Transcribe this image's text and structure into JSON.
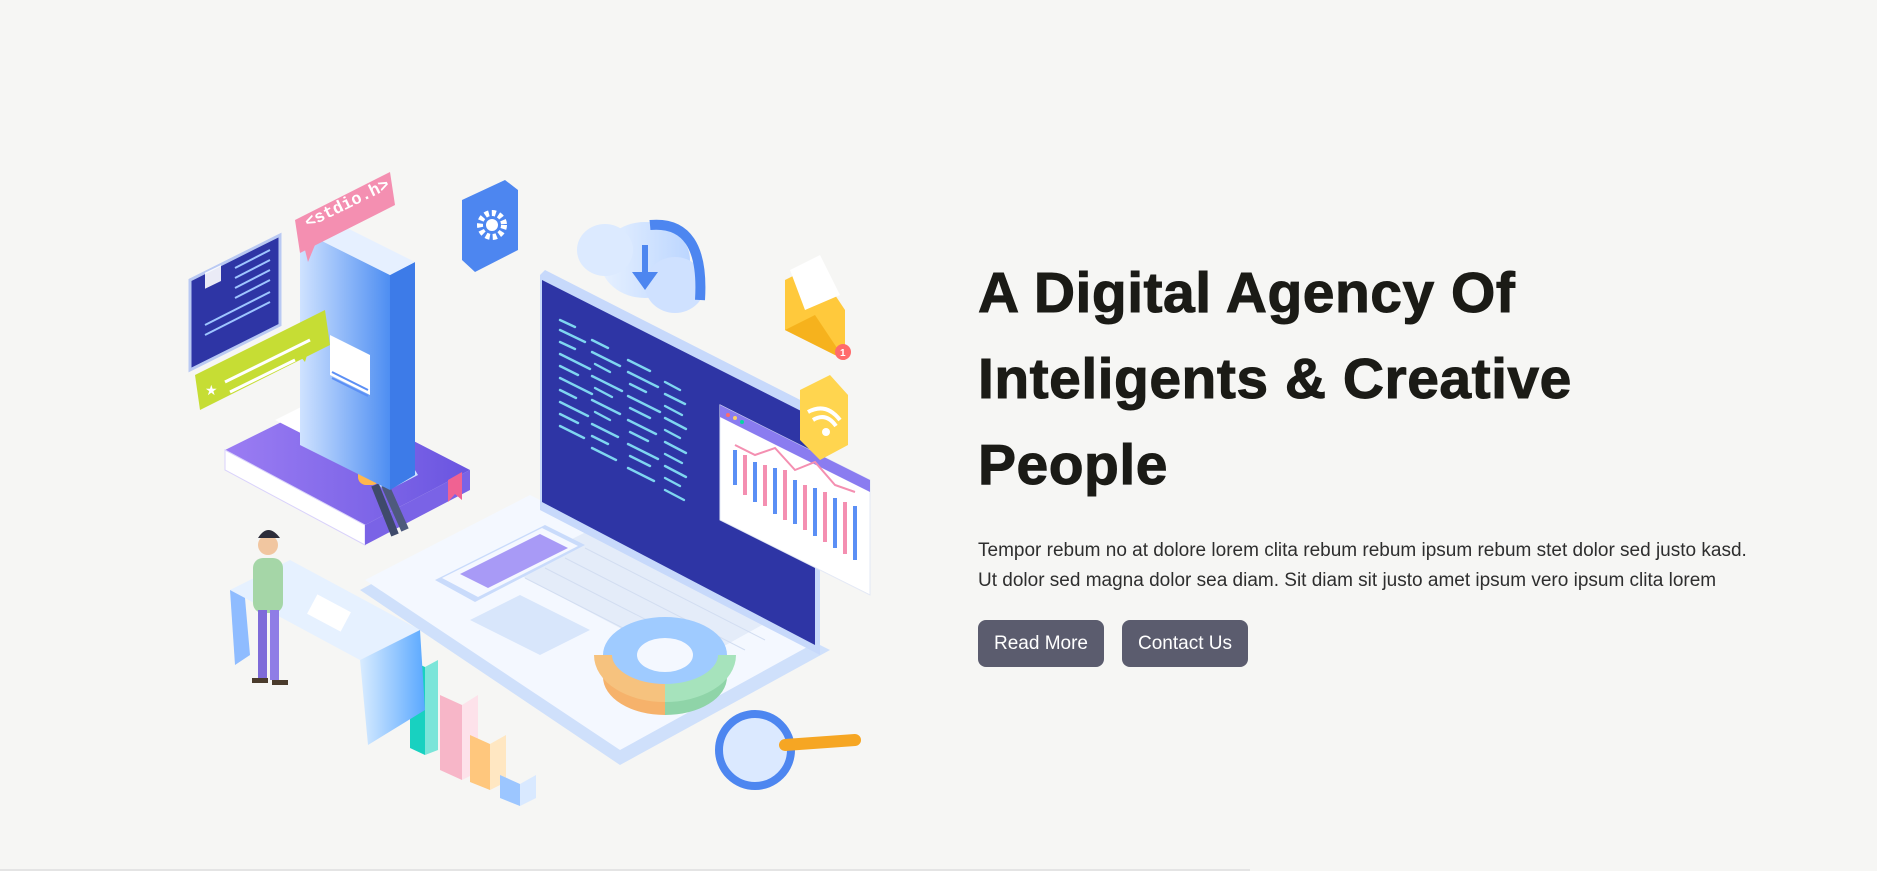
{
  "hero": {
    "title_lines": [
      "A Digital Agency Of",
      "Inteligents & Creative",
      "People"
    ],
    "description": "Tempor rebum no at dolore lorem clita rebum rebum ipsum rebum stet dolor sed justo kasd. Ut dolor sed magna dolor sea diam. Sit diam sit justo amet ipsum vero ipsum clita lorem",
    "read_more_label": "Read More",
    "contact_label": "Contact Us"
  },
  "illustration": {
    "code_tag": "<stdio.h>",
    "icons": [
      "gear-icon",
      "cloud-download-icon",
      "mail-icon",
      "wifi-icon",
      "magnifier-icon",
      "profile-card-icon",
      "chat-bubble-icon"
    ],
    "colors": {
      "screen": "#2a2f9c",
      "laptop_body": "#eef4ff",
      "book_blue": "#5b9cf5",
      "book_purple": "#8b6ff0",
      "accent_pink": "#f48fb1",
      "accent_yellow": "#ffc93c",
      "accent_green": "#c6dd34"
    }
  }
}
